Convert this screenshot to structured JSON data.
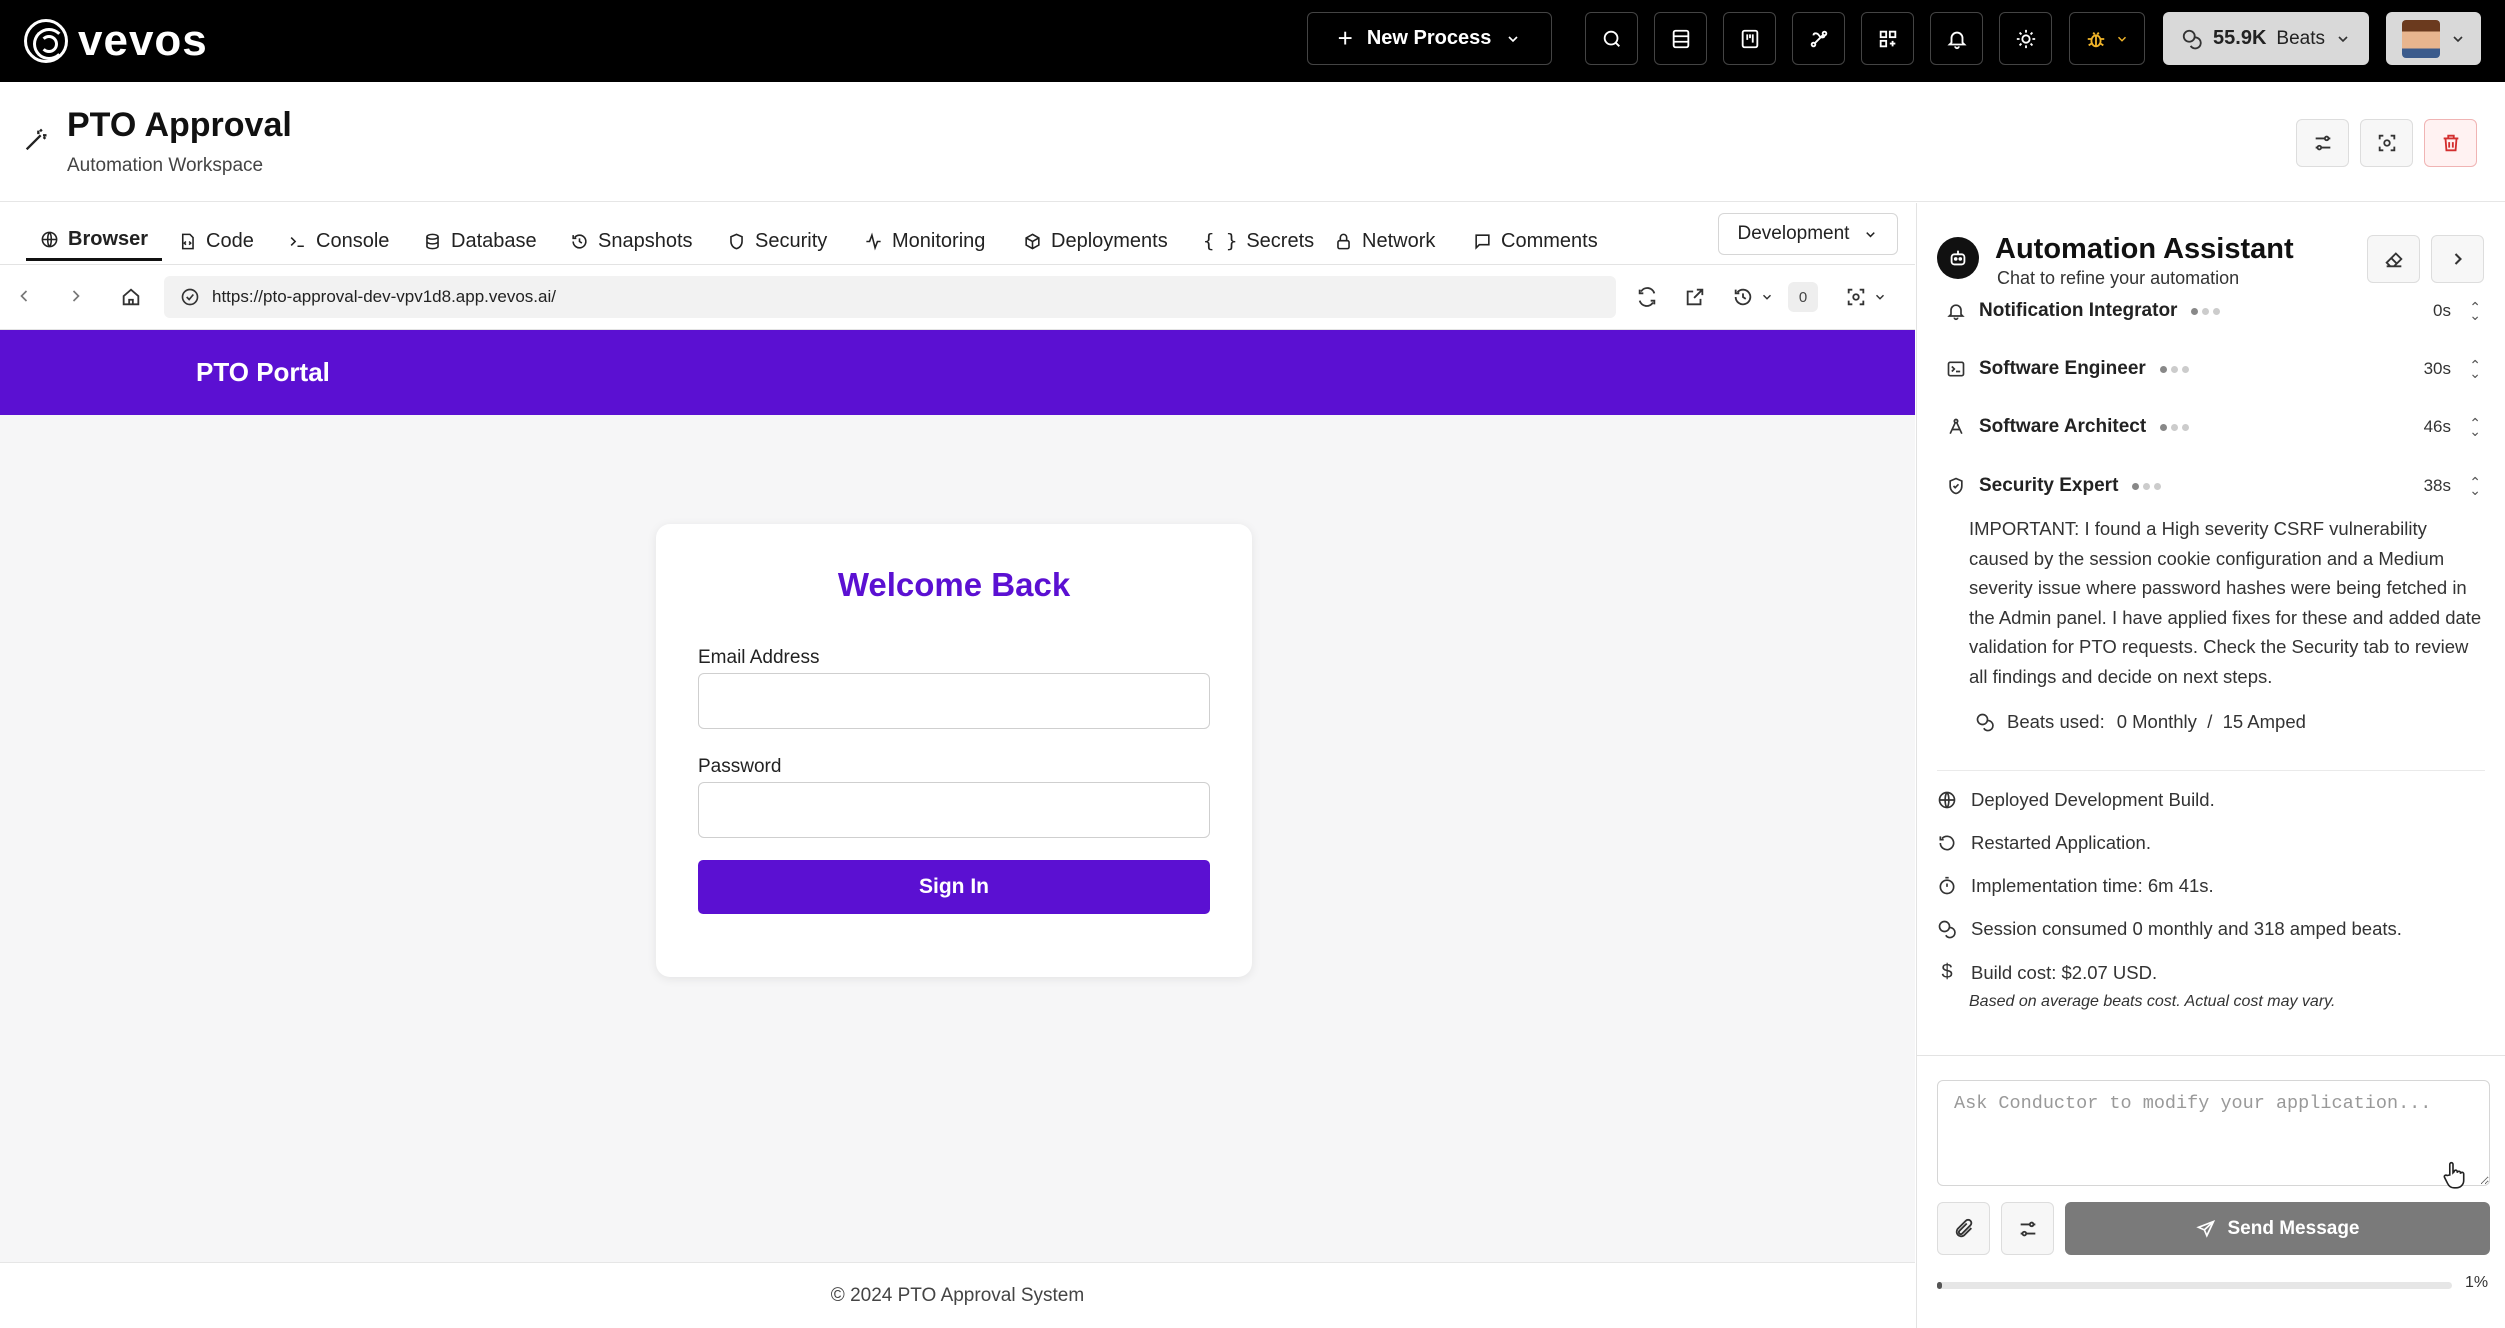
{
  "topbar": {
    "logo_text": "vevos",
    "new_process_label": "New Process",
    "beats_value": "55.9K",
    "beats_label": "Beats",
    "icons": [
      "search-icon",
      "table-icon",
      "kanban-icon",
      "integrations-icon",
      "apps-grid-icon",
      "bell-icon",
      "sun-icon",
      "bug-icon"
    ]
  },
  "header": {
    "title": "PTO Approval",
    "subtitle": "Automation Workspace"
  },
  "tabs": [
    {
      "label": "Browser",
      "icon": "globe-icon",
      "active": true
    },
    {
      "label": "Code",
      "icon": "file-code-icon"
    },
    {
      "label": "Console",
      "icon": "terminal-icon"
    },
    {
      "label": "Database",
      "icon": "database-icon"
    },
    {
      "label": "Snapshots",
      "icon": "history-icon"
    },
    {
      "label": "Security",
      "icon": "shield-icon"
    },
    {
      "label": "Monitoring",
      "icon": "activity-icon"
    },
    {
      "label": "Deployments",
      "icon": "package-icon"
    },
    {
      "label": "Secrets",
      "icon": "braces-icon"
    },
    {
      "label": "Network",
      "icon": "lock-icon"
    },
    {
      "label": "Comments",
      "icon": "message-icon"
    }
  ],
  "environment": {
    "selected": "Development"
  },
  "urlbar": {
    "url": "https://pto-approval-dev-vpv1d8.app.vevos.ai/",
    "snapshot_count": "0"
  },
  "preview": {
    "portal_title": "PTO Portal",
    "login_title": "Welcome Back",
    "email_label": "Email Address",
    "password_label": "Password",
    "signin_label": "Sign In",
    "footer": "© 2024 PTO Approval System"
  },
  "assistant": {
    "title": "Automation Assistant",
    "subtitle": "Chat to refine your automation",
    "agents": [
      {
        "name": "Notification Integrator",
        "time": "0s",
        "icon": "bell-icon"
      },
      {
        "name": "Software Engineer",
        "time": "30s",
        "icon": "terminal-icon"
      },
      {
        "name": "Software Architect",
        "time": "46s",
        "icon": "compass-icon"
      },
      {
        "name": "Security Expert",
        "time": "38s",
        "icon": "shield-check-icon"
      }
    ],
    "message": "IMPORTANT: I found a High severity CSRF vulnerability caused by the session cookie configuration and a Medium severity issue where password hashes were being fetched in the Admin panel. I have applied fixes for these and added date validation for PTO requests. Check the Security tab to review all findings and decide on next steps.",
    "beats_used_label": "Beats used:",
    "beats_used_value": "0 Monthly  /  15 Amped",
    "status": [
      {
        "text": "Deployed Development Build.",
        "icon": "globe-icon"
      },
      {
        "text": "Restarted Application.",
        "icon": "restart-icon"
      },
      {
        "text": "Implementation time: 6m 41s.",
        "icon": "timer-icon"
      },
      {
        "text": "Session consumed 0 monthly and 318 amped beats.",
        "icon": "coins-icon"
      },
      {
        "text": "Build cost: $2.07 USD.",
        "icon": "dollar-icon"
      }
    ],
    "cost_note": "Based on average beats cost. Actual cost may vary.",
    "input_placeholder": "Ask Conductor to modify your application...",
    "send_label": "Send Message",
    "progress_percent": 1,
    "progress_label": "1%"
  }
}
